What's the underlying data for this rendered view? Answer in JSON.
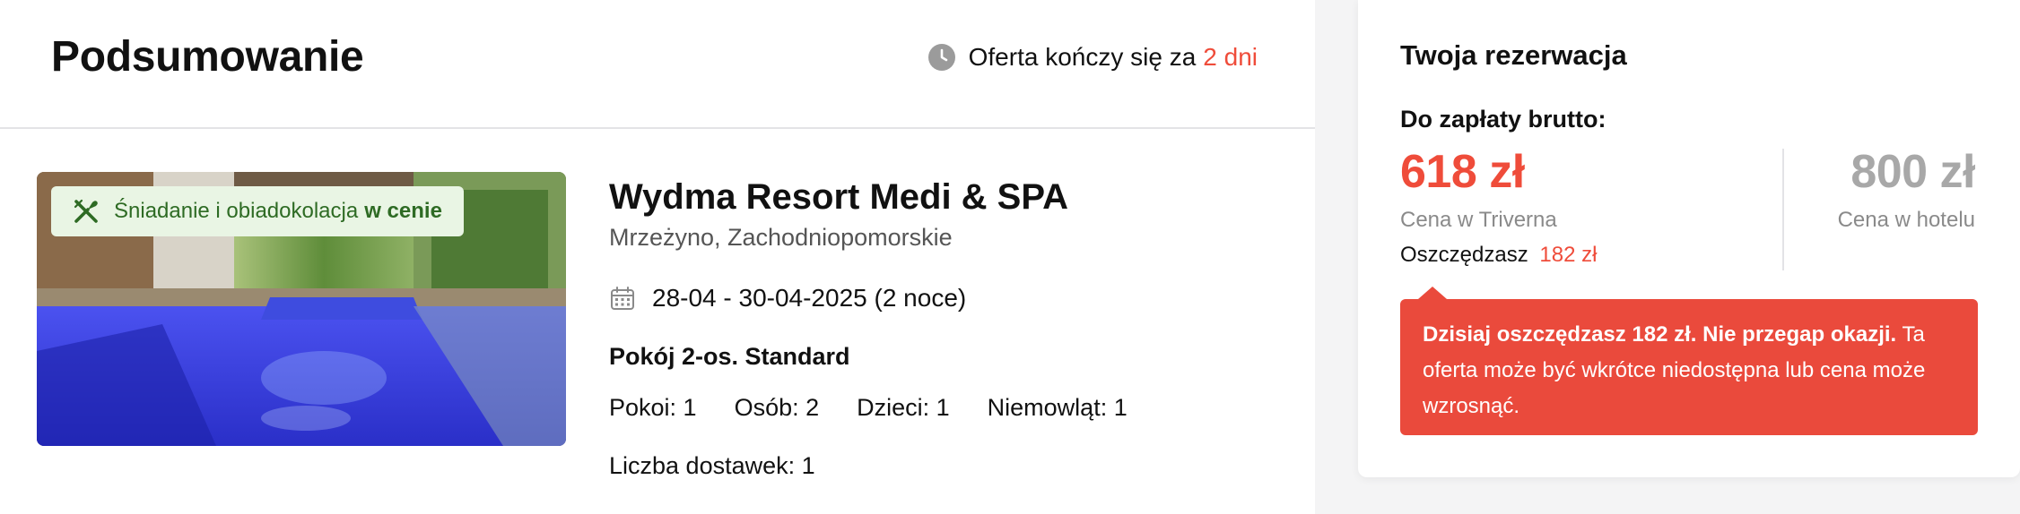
{
  "summary": {
    "title": "Podsumowanie",
    "offer_end_prefix": "Oferta kończy się za",
    "offer_end_value": "2 dni",
    "board_badge_prefix": "Śniadanie i obiadokolacja",
    "board_badge_bold": "w cenie",
    "hotel_name": "Wydma Resort Medi & SPA",
    "hotel_location": "Mrzeżyno, Zachodniopomorskie",
    "dates": "28-04 - 30-04-2025 (2 noce)",
    "room": "Pokój 2-os. Standard",
    "occupancy": {
      "rooms": "Pokoi: 1",
      "persons": "Osób: 2",
      "children": "Dzieci: 1",
      "infants": "Niemowląt: 1"
    },
    "deliveries": "Liczba dostawek: 1"
  },
  "booking": {
    "title": "Twoja rezerwacja",
    "to_pay_label": "Do zapłaty brutto:",
    "price": "618 zł",
    "price_label": "Cena w Triverna",
    "savings_prefix": "Oszczędzasz",
    "savings_amount": "182 zł",
    "hotel_price": "800 zł",
    "hotel_price_label": "Cena w hotelu",
    "alert_bold": "Dzisiaj oszczędzasz 182 zł. Nie przegap okazji.",
    "alert_text": " Ta oferta może być wkrótce niedostępna lub cena może wzrosnąć."
  },
  "icons": {
    "clock": "clock-icon",
    "fork_knife": "fork-knife-icon",
    "calendar": "calendar-icon"
  },
  "colors": {
    "accent": "#ef4c3a",
    "alert_bg": "#ea4a3c",
    "badge_bg": "#e9f5e4",
    "badge_text": "#2e6b24",
    "muted_price": "#a8a8a8"
  }
}
